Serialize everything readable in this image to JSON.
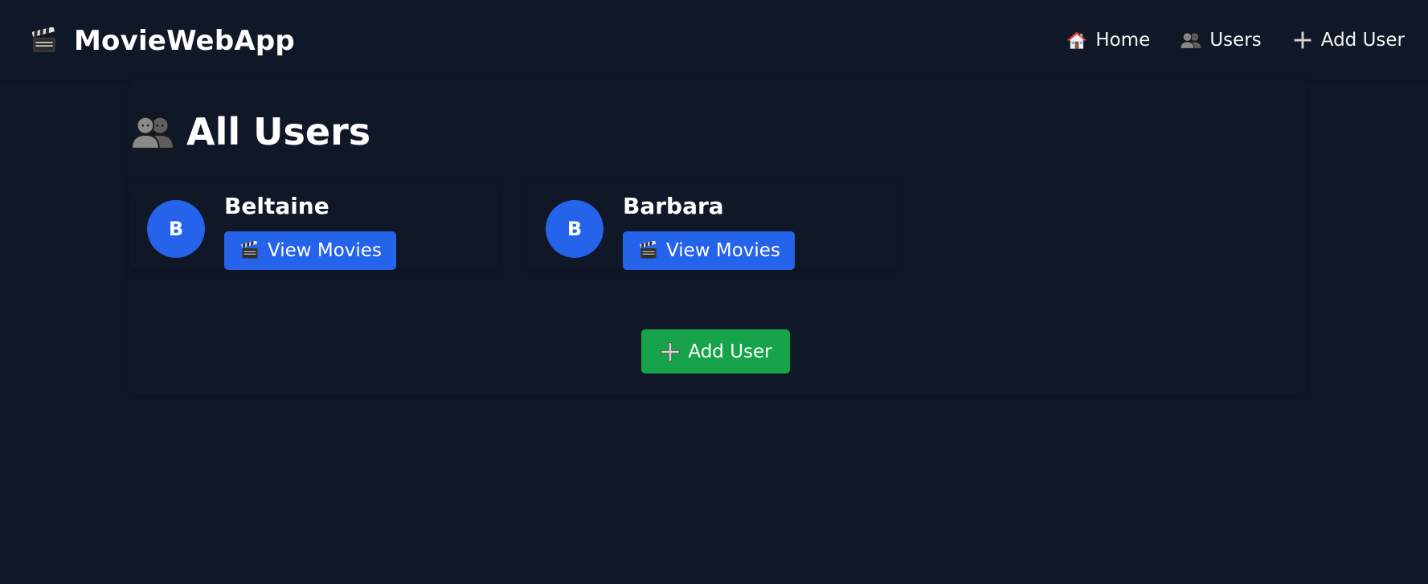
{
  "nav": {
    "brand_title": "MovieWebApp",
    "brand_icon": "clapperboard-icon",
    "links": [
      {
        "label": "Home",
        "icon": "house-icon"
      },
      {
        "label": "Users",
        "icon": "users-icon"
      },
      {
        "label": "Add User",
        "icon": "plus-icon"
      }
    ]
  },
  "main": {
    "heading": "All Users",
    "heading_icon": "users-icon",
    "users": [
      {
        "initial": "B",
        "name": "Beltaine",
        "button_label": "View Movies",
        "button_icon": "clapperboard-icon"
      },
      {
        "initial": "B",
        "name": "Barbara",
        "button_label": "View Movies",
        "button_icon": "clapperboard-icon"
      }
    ],
    "add_button_label": "Add User",
    "add_button_icon": "plus-icon"
  },
  "colors": {
    "background": "#111827",
    "primary": "#2563eb",
    "success": "#16a34a",
    "text": "#ffffff"
  }
}
